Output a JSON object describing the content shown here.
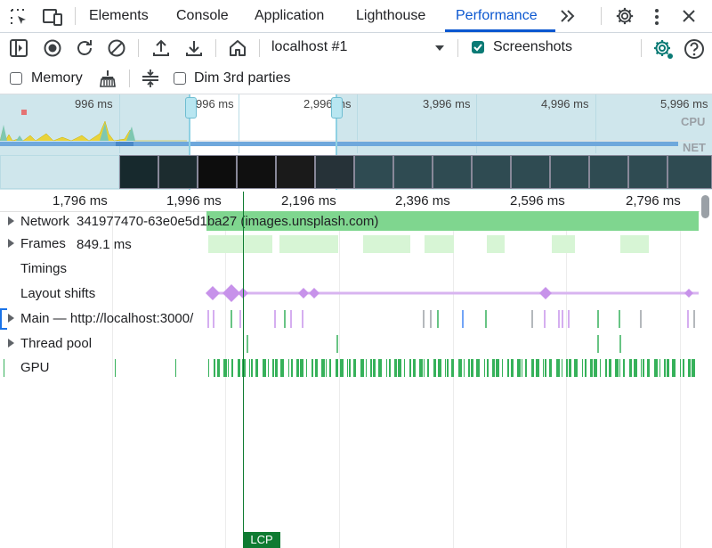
{
  "tabs": [
    {
      "label": "Elements"
    },
    {
      "label": "Console"
    },
    {
      "label": "Application"
    },
    {
      "label": "Lighthouse"
    },
    {
      "label": "Performance"
    }
  ],
  "toolbar": {
    "target": "localhost #1",
    "screenshots_label": "Screenshots",
    "memory_label": "Memory",
    "dim_label": "Dim 3rd parties"
  },
  "overview": {
    "ticks": [
      "996 ms",
      "996 ms",
      "2,996 ms",
      "3,996 ms",
      "4,996 ms",
      "5,996 ms"
    ],
    "cpu_label": "CPU",
    "net_label": "NET"
  },
  "ruler": {
    "ticks": [
      "1,796 ms",
      "1,996 ms",
      "2,196 ms",
      "2,396 ms",
      "2,596 ms",
      "2,796 ms"
    ]
  },
  "tracks": {
    "network": {
      "name": "Network",
      "request": "341977470-63e0e5d1ba27 (images.unsplash.com)"
    },
    "frames": {
      "name": "Frames",
      "value": "849.1 ms"
    },
    "timings": {
      "name": "Timings"
    },
    "layout_shifts": {
      "name": "Layout shifts"
    },
    "main": {
      "name": "Main — http://localhost:3000/"
    },
    "thread_pool": {
      "name": "Thread pool"
    },
    "gpu": {
      "name": "GPU"
    }
  },
  "markers": {
    "lcp": "LCP"
  },
  "colors": {
    "accent": "#0b57d0",
    "network_bar": "#7fd68f",
    "frames": "#d7f5d5",
    "layout_shift": "#c792ea",
    "gpu": "#36b15a",
    "lcp": "#0f7b32"
  }
}
